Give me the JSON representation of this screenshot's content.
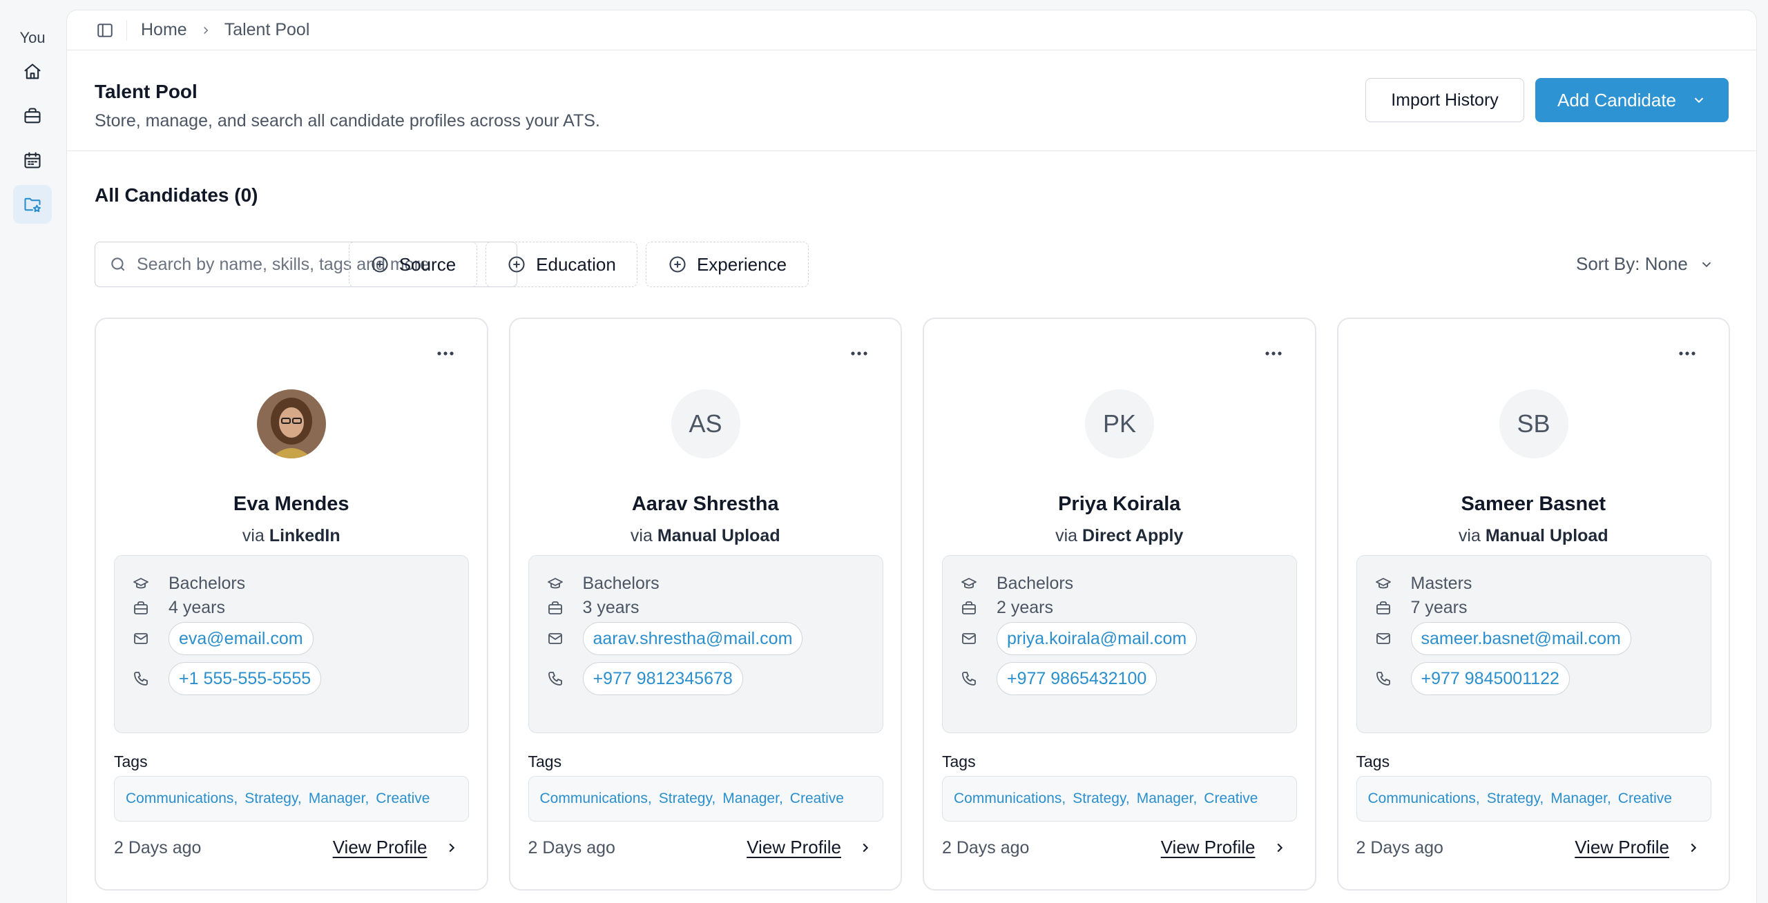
{
  "rail": {
    "user_label": "You",
    "items": [
      {
        "icon": "home-icon"
      },
      {
        "icon": "briefcase-icon"
      },
      {
        "icon": "calendar-icon"
      },
      {
        "icon": "folder-star-icon",
        "active": true
      }
    ]
  },
  "breadcrumb": {
    "home": "Home",
    "current": "Talent Pool"
  },
  "header": {
    "title": "Talent Pool",
    "subtitle": "Store, manage, and search all candidate profiles across your ATS.",
    "import_label": "Import History",
    "add_label": "Add Candidate"
  },
  "list": {
    "title": "All Candidates (0)",
    "search_placeholder": "Search by name, skills, tags and more",
    "filters": {
      "source": "Source",
      "education": "Education",
      "experience": "Experience"
    },
    "sort_label": "Sort By: None",
    "tags_label": "Tags",
    "view_profile_label": "View Profile",
    "via_prefix": "via"
  },
  "candidates": [
    {
      "name": "Eva Mendes",
      "initials": "",
      "has_photo": true,
      "source": "LinkedIn",
      "education": "Bachelors",
      "experience": "4 years",
      "email": "eva@email.com",
      "phone": "+1 555-555-5555",
      "tags": [
        "Communications,",
        "Strategy,",
        "Manager,",
        "Creative"
      ],
      "added": "2 Days ago"
    },
    {
      "name": "Aarav Shrestha",
      "initials": "AS",
      "has_photo": false,
      "source": "Manual Upload",
      "education": "Bachelors",
      "experience": "3 years",
      "email": "aarav.shrestha@mail.com",
      "phone": "+977 9812345678",
      "tags": [
        "Communications,",
        "Strategy,",
        "Manager,",
        "Creative"
      ],
      "added": "2 Days ago"
    },
    {
      "name": "Priya Koirala",
      "initials": "PK",
      "has_photo": false,
      "source": "Direct Apply",
      "education": "Bachelors",
      "experience": "2 years",
      "email": "priya.koirala@mail.com",
      "phone": "+977 9865432100",
      "tags": [
        "Communications,",
        "Strategy,",
        "Manager,",
        "Creative"
      ],
      "added": "2 Days ago"
    },
    {
      "name": "Sameer Basnet",
      "initials": "SB",
      "has_photo": false,
      "source": "Manual Upload",
      "education": "Masters",
      "experience": "7 years",
      "email": "sameer.basnet@mail.com",
      "phone": "+977 9845001122",
      "tags": [
        "Communications,",
        "Strategy,",
        "Manager,",
        "Creative"
      ],
      "added": "2 Days ago"
    }
  ],
  "colors": {
    "accent": "#2d93d3",
    "link": "#2b8fce",
    "active_nav_bg": "#e3eef8"
  }
}
